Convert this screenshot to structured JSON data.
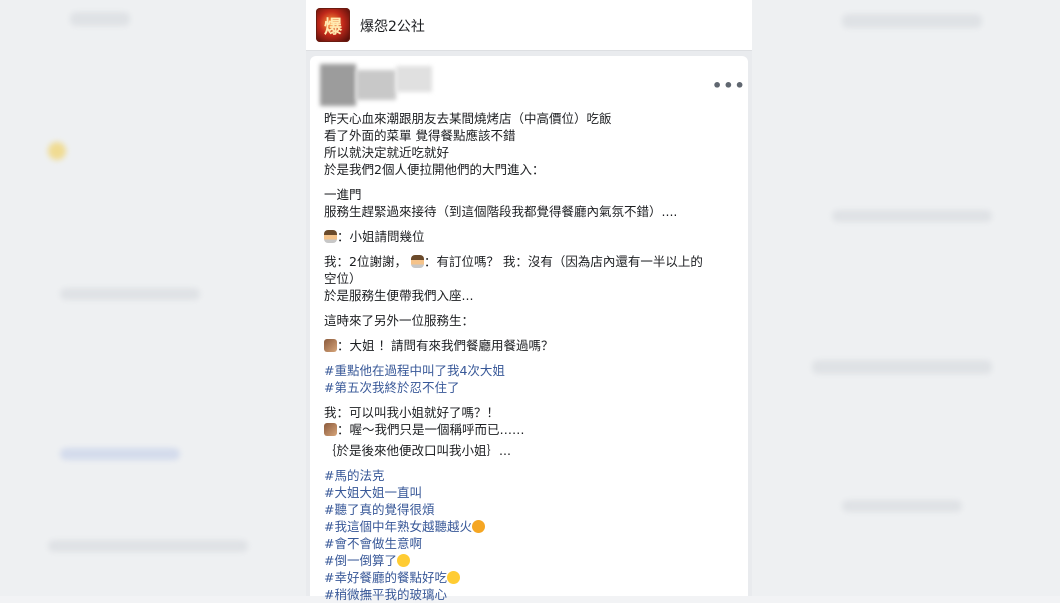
{
  "group": {
    "logo_text": "爆",
    "name": "爆怨2公社"
  },
  "post": {
    "more_label": "•••",
    "lines": [
      "昨天心血來潮跟朋友去某間燒烤店（中高價位）吃飯",
      "看了外面的菜單 覺得餐點應該不錯",
      "所以就決定就近吃就好",
      "於是我們2個人便拉開他們的大門進入：",
      "一進門",
      "服務生趕緊過來接待（到這個階段我都覺得餐廳內氣氛不錯）....",
      "：小姐請問幾位",
      "我：2位謝謝，",
      "：有訂位嗎？ 我：沒有（因為店內還有一半以上的",
      "空位）",
      "於是服務生便帶我們入座...",
      "這時來了另外一位服務生：",
      "：大姐 ！請問有來我們餐廳用餐過嗎？",
      "#重點他在過程中叫了我4次大姐",
      "#第五次我終於忍不住了",
      "我：可以叫我小姐就好了嗎？！",
      "：喔～我們只是一個稱呼而已……",
      "｛於是後來他便改口叫我小姐｝...",
      "#馬的法克",
      "#大姐大姐一直叫",
      "#聽了真的覺得很煩",
      "#我這個中年熟女越聽越火",
      "#會不會做生意啊",
      "#倒一倒算了",
      "#幸好餐廳的餐點好吃",
      "#稍微撫平我的玻璃心"
    ]
  },
  "icons": {
    "staff": "staff-emoji-icon",
    "man": "man-emoji-icon",
    "angry": "angry-face-icon",
    "rofl": "rofl-face-icon",
    "smile": "smiling-face-icon"
  }
}
